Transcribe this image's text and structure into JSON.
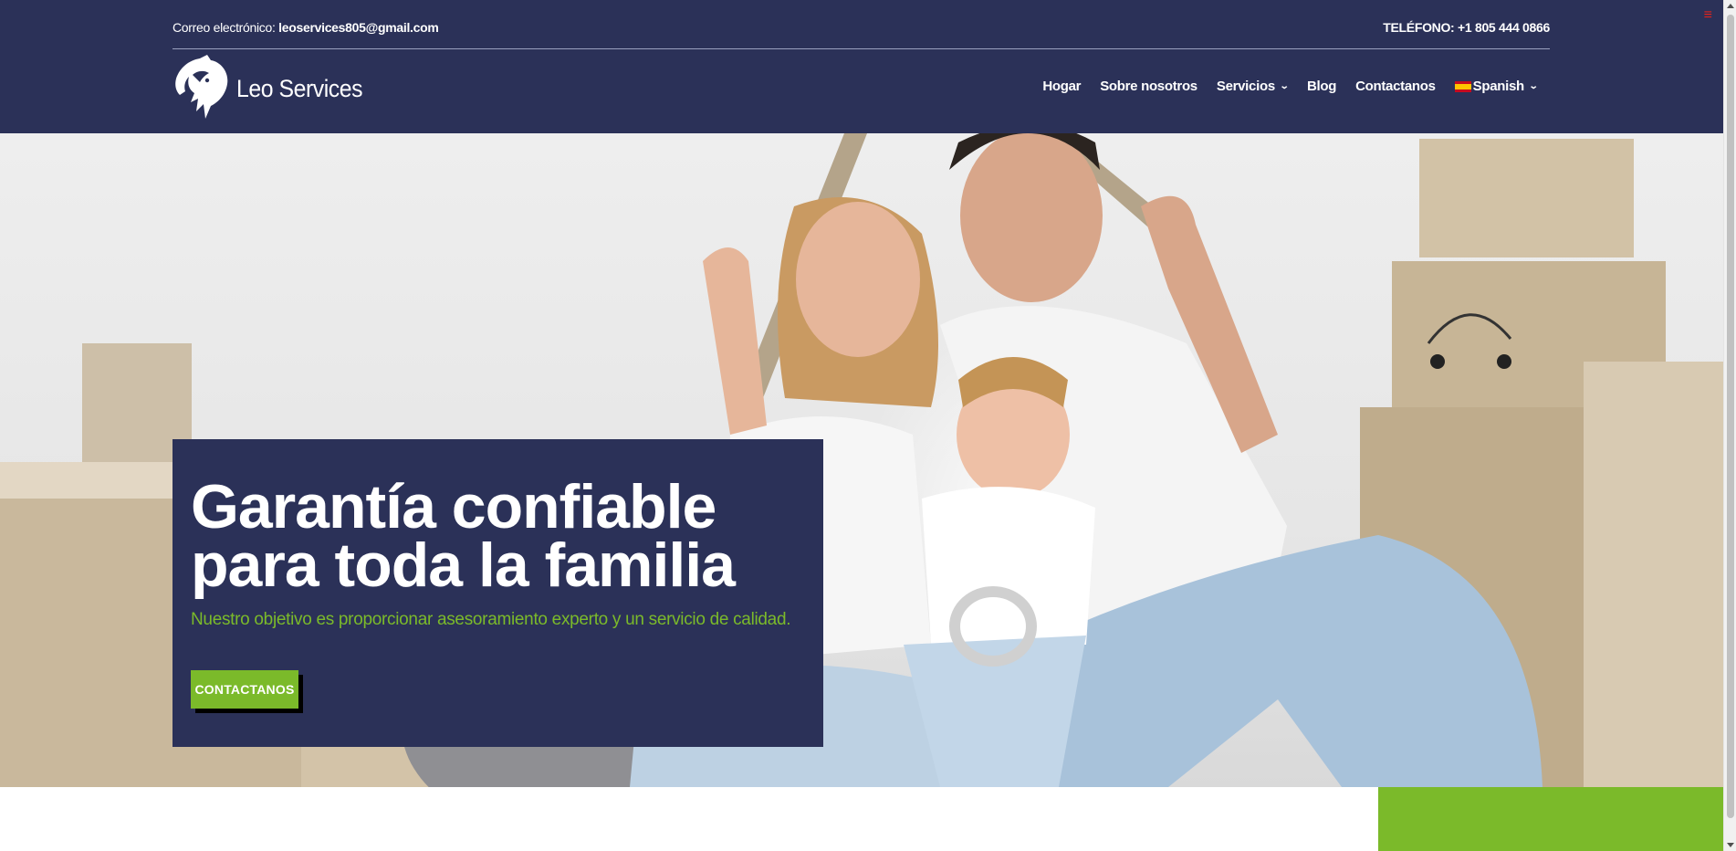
{
  "topbar": {
    "email_label": "Correo electrónico:",
    "email_value": "leoservices805@gmail.com",
    "phone": "TELÉFONO: +1 805 444 0866"
  },
  "brand": {
    "name": "Leo Services"
  },
  "nav": {
    "items": [
      {
        "label": "Hogar"
      },
      {
        "label": "Sobre nosotros"
      },
      {
        "label": "Servicios",
        "has_dropdown": true
      },
      {
        "label": "Blog"
      },
      {
        "label": "Contactanos"
      },
      {
        "label": "Spanish",
        "has_dropdown": true,
        "icon": "spain-flag-icon"
      }
    ]
  },
  "hero": {
    "title": "Garantía confiable para toda la familia",
    "subtitle": "Nuestro objetivo es proporcionar asesoramiento experto y un servicio de calidad.",
    "cta": "CONTACTANOS"
  },
  "colors": {
    "navy": "#2b3158",
    "accent_green": "#7bba2a",
    "menu_red": "#e0231c"
  }
}
